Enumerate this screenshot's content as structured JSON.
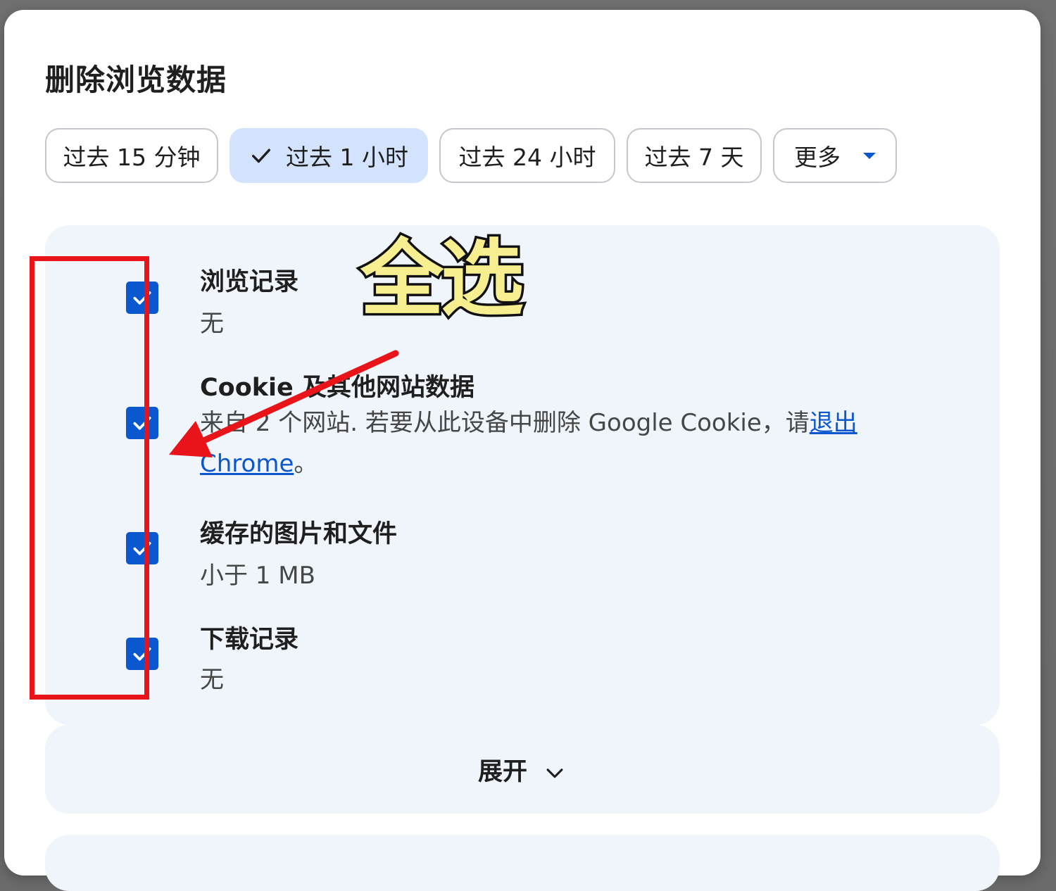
{
  "dialog": {
    "title": "删除浏览数据"
  },
  "time_range": {
    "chips": [
      {
        "label": "过去 15 分钟",
        "selected": false
      },
      {
        "label": "过去 1 小时",
        "selected": true
      },
      {
        "label": "过去 24 小时",
        "selected": false
      },
      {
        "label": "过去 7 天",
        "selected": false
      },
      {
        "label": "更多",
        "selected": false,
        "has_dropdown": true
      }
    ]
  },
  "items": [
    {
      "title": "浏览记录",
      "subtitle": "无",
      "checked": true
    },
    {
      "title": "Cookie 及其他网站数据",
      "subtitle_prefix": "来自 2 个网站. 若要从此设备中删除 Google Cookie，请",
      "link_text": "退出 Chrome",
      "subtitle_suffix": "。",
      "checked": true
    },
    {
      "title": "缓存的图片和文件",
      "subtitle": "小于 1 MB",
      "checked": true
    },
    {
      "title": "下载记录",
      "subtitle": "无",
      "checked": true
    }
  ],
  "expand": {
    "label": "展开"
  },
  "annotation": {
    "text": "全选"
  },
  "colors": {
    "accent": "#0b57d0",
    "selected_chip_bg": "#d3e3fd",
    "panel_bg": "#f0f4fb",
    "annotation_red": "#e8141a",
    "annotation_yellow": "#f7ef8f"
  },
  "icons": {
    "chip_check": "check-icon",
    "dropdown": "caret-down-icon",
    "checkbox": "checkbox-checked-icon",
    "expand": "chevron-down-icon"
  }
}
